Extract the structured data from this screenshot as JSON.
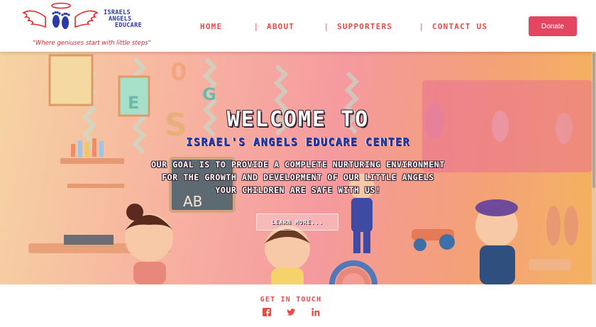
{
  "header": {
    "logo_name": [
      "ISRAELS",
      "ANGELS",
      "EDUCARE"
    ],
    "tagline": "\"Where geniuses start with little steps\"",
    "nav": [
      {
        "label": "HOME"
      },
      {
        "label": "ABOUT"
      },
      {
        "label": "SUPPORTERS"
      },
      {
        "label": "CONTACT US"
      }
    ],
    "nav_separator": "|",
    "donate_label": "Donate"
  },
  "hero": {
    "title": "WELCOME TO",
    "subtitle": "ISRAEL'S ANGELS EDUCARE CENTER",
    "body_line1": "OUR GOAL IS TO PROVIDE A COMPLETE NURTURING ENVIRONMENT FOR THE GROWTH AND DEVELOPMENT OF OUR LITTLE ANGELS",
    "body_line2": "YOUR CHILDREN ARE SAFE WITH US!",
    "cta_label": "LEARN MORE..."
  },
  "footer": {
    "heading": "GET IN TOUCH",
    "social": [
      {
        "icon": "facebook-icon"
      },
      {
        "icon": "twitter-icon"
      },
      {
        "icon": "linkedin-icon"
      }
    ]
  },
  "colors": {
    "accent": "#e94b47",
    "donate": "#e44561",
    "brand_blue": "#2b3aa6"
  }
}
